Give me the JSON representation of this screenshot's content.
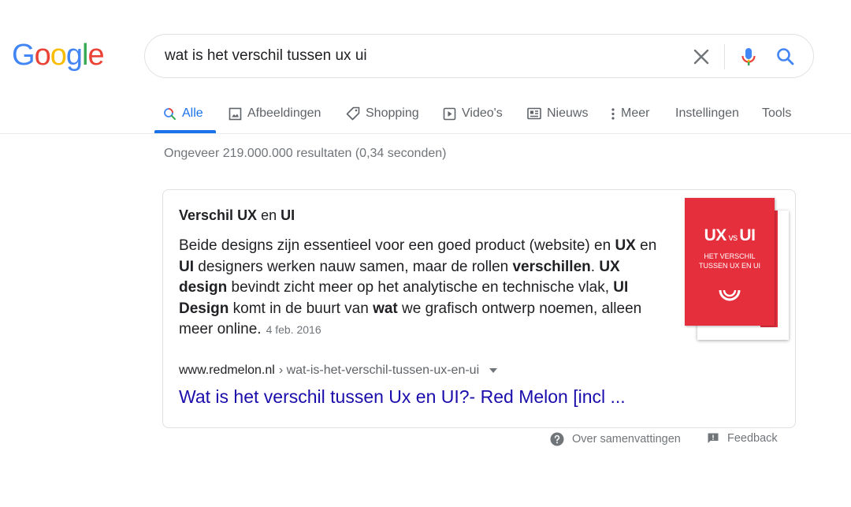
{
  "logo": {
    "text": "Google",
    "colors": [
      "#4285f4",
      "#ea4335",
      "#fbbc05",
      "#4285f4",
      "#34a853",
      "#ea4335"
    ]
  },
  "search": {
    "query": "wat is het verschil tussen ux ui",
    "clear_icon": "close-icon",
    "mic_icon": "microphone-icon",
    "search_icon": "search-icon"
  },
  "tabs": [
    {
      "label": "Alle",
      "icon": "search-icon",
      "active": true
    },
    {
      "label": "Afbeeldingen",
      "icon": "image-icon"
    },
    {
      "label": "Shopping",
      "icon": "tag-icon"
    },
    {
      "label": "Video's",
      "icon": "play-icon"
    },
    {
      "label": "Nieuws",
      "icon": "news-icon"
    },
    {
      "label": "Meer",
      "icon": "more-vert-icon"
    },
    {
      "label": "Instellingen"
    },
    {
      "label": "Tools"
    }
  ],
  "result_stats": "Ongeveer 219.000.000 resultaten (0,34 seconden)",
  "featured_snippet": {
    "title_parts": [
      "Verschil ",
      "UX",
      " en ",
      "UI"
    ],
    "body_parts": [
      "Beide designs zijn essentieel voor een goed product (website) en ",
      "UX",
      " en ",
      "UI",
      " designers werken nauw samen, maar de rollen ",
      "verschillen",
      ". ",
      "UX design",
      " bevindt zicht meer op het analytische en technische vlak, ",
      "UI Design",
      " komt in de buurt van ",
      "wat",
      " we grafisch ontwerp noemen, alleen meer online."
    ],
    "date": "4 feb. 2016",
    "image": {
      "title_ux": "UX",
      "title_vs": " vs ",
      "title_ui": "UI",
      "subtitle": "HET VERSCHIL TUSSEN UX EN UI",
      "color": "#e52f3d"
    },
    "cite_domain": "www.redmelon.nl",
    "cite_path": " › wat-is-het-verschil-tussen-ux-en-ui",
    "link": "Wat is het verschil tussen Ux en UI?- Red Melon [incl ..."
  },
  "footer": {
    "about": "Over samenvattingen",
    "about_icon": "help-circle-icon",
    "feedback": "Feedback",
    "feedback_icon": "feedback-icon"
  }
}
